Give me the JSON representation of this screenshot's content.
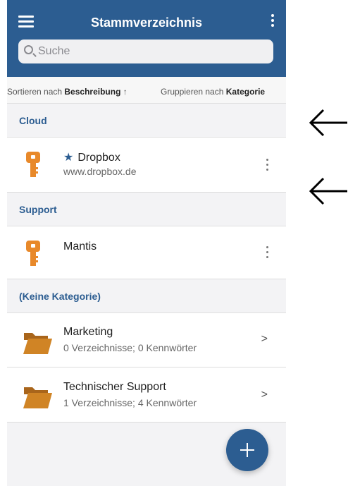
{
  "header": {
    "title": "Stammverzeichnis"
  },
  "search": {
    "placeholder": "Suche"
  },
  "sort": {
    "sort_prefix": "Sortieren nach",
    "sort_field": "Beschreibung",
    "sort_direction": "↑",
    "group_prefix": "Gruppieren nach",
    "group_field": "Kategorie"
  },
  "sections": [
    {
      "label": "Cloud",
      "items": [
        {
          "title": "Dropbox",
          "subtitle": "www.dropbox.de",
          "favorite": true,
          "icon": "key-icon"
        }
      ]
    },
    {
      "label": "Support",
      "items": [
        {
          "title": "Mantis",
          "subtitle": "",
          "favorite": false,
          "icon": "key-icon"
        }
      ]
    },
    {
      "label": "(Keine Kategorie)",
      "items": [
        {
          "title": "Marketing",
          "subtitle": "0 Verzeichnisse; 0 Kennwörter",
          "icon": "folder-icon"
        },
        {
          "title": "Technischer Support",
          "subtitle": "1 Verzeichnisse; 4 Kennwörter",
          "icon": "folder-icon"
        }
      ]
    }
  ],
  "colors": {
    "primary": "#2c5d91",
    "key": "#e8892a",
    "folder": "#c67a22"
  }
}
